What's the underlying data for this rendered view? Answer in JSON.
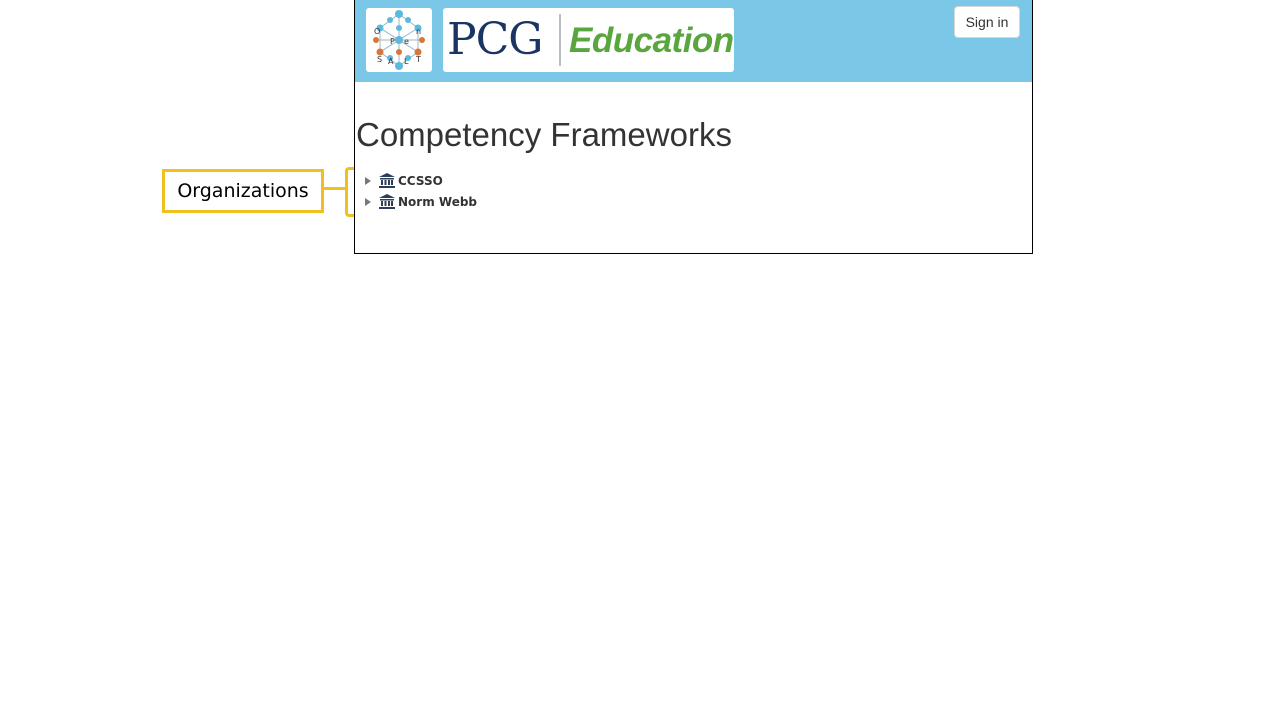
{
  "annotation": {
    "label": "Organizations",
    "color": "#f0c020"
  },
  "header": {
    "background": "#7ac7e8",
    "logo_icon": "opensalt-logo",
    "logo_letters": [
      "O",
      "P",
      "e",
      "n",
      "S",
      "A",
      "L",
      "T"
    ],
    "brand_left": "PCG",
    "brand_right": "Education",
    "signin_label": "Sign in"
  },
  "page": {
    "title": "Competency Frameworks"
  },
  "organizations": [
    {
      "label": "CCSSO",
      "icon": "bank-icon",
      "expanded": false
    },
    {
      "label": "Norm Webb",
      "icon": "bank-icon",
      "expanded": false
    }
  ]
}
